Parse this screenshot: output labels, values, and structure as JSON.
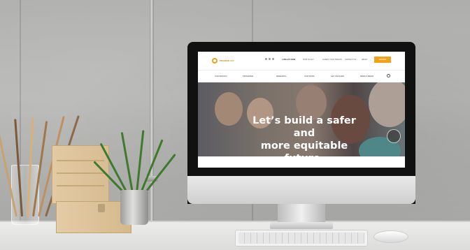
{
  "website": {
    "logo_text": "PROMISE ACT",
    "util_nav": [
      "HOW TO ACT",
      "GUARD YOUR TRACKS",
      "CONTACT US",
      "ABOUT"
    ],
    "phone": "1-800-ACT-NOW",
    "cta_label": "DONATE",
    "nav_items": [
      "OUR MISSION",
      "PROGRAMS",
      "RESEARCH",
      "OUR WORK",
      "GET INVOLVED",
      "NEWS & MEDIA"
    ],
    "hero_headline_line1": "Let’s build a safer and",
    "hero_headline_line2": "more equitable future."
  },
  "colors": {
    "accent": "#f0a21b",
    "desk": "#e6e6e4",
    "wall": "#b2b2b0"
  }
}
